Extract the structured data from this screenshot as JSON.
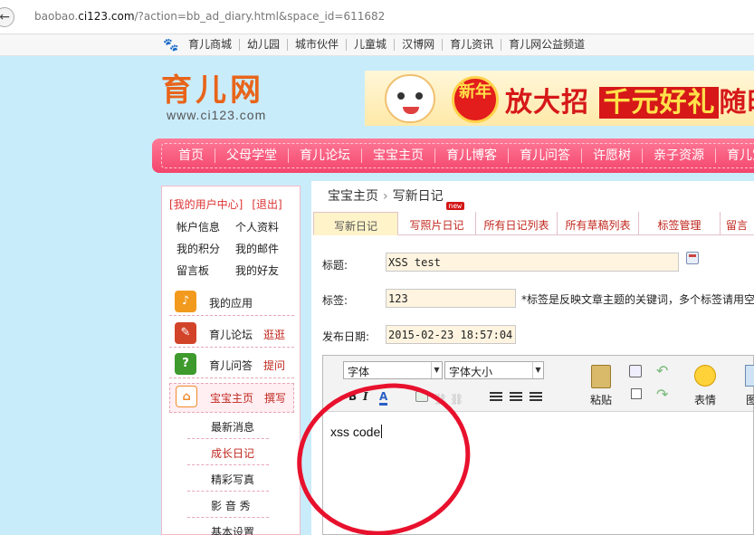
{
  "browser": {
    "url_prefix": "baobao.",
    "url_domain": "ci123.com",
    "url_path": "/?action=bb_ad_diary.html&space_id=611682"
  },
  "topnav": {
    "items": [
      "育儿商城",
      "幼儿园",
      "城市伙伴",
      "儿童城",
      "汉博网",
      "育儿资讯",
      "育儿网公益频道"
    ]
  },
  "logo": {
    "cn": "育儿网",
    "en": "www.ci123.com"
  },
  "banner": {
    "badge": "新年",
    "slogan_a": "放大招",
    "slogan_b": "千元好礼",
    "slogan_c": "随时"
  },
  "mainmenu": {
    "items": [
      "首页",
      "父母学堂",
      "育儿论坛",
      "宝宝主页",
      "育儿博客",
      "育儿问答",
      "许愿树",
      "亲子资源",
      "育儿宝"
    ]
  },
  "sidebar": {
    "user_center": "[我的用户中心]",
    "logout": "[退出]",
    "links": [
      [
        "帐户信息",
        "个人资料"
      ],
      [
        "我的积分",
        "我的邮件"
      ],
      [
        "留言板",
        "我的好友"
      ]
    ],
    "apps": [
      {
        "label": "我的应用",
        "action": "",
        "color": "#f29a1d",
        "icon": "app-icon"
      },
      {
        "label": "育儿论坛",
        "action": "逛逛",
        "color": "#d2442a",
        "icon": "forum-icon"
      },
      {
        "label": "育儿问答",
        "action": "提问",
        "color": "#3e9a2d",
        "icon": "question-icon"
      },
      {
        "label": "宝宝主页",
        "action": "撰写",
        "color": "#f08a2a",
        "icon": "home-icon"
      }
    ],
    "submenu": [
      "最新消息",
      "成长日记",
      "精彩写真",
      "影 音 秀",
      "基本设置"
    ]
  },
  "content": {
    "breadcrumb": [
      "宝宝主页",
      "写新日记"
    ],
    "tabs": [
      "写新日记",
      "写照片日记",
      "所有日记列表",
      "所有草稿列表",
      "标签管理",
      "留言"
    ],
    "new_badge": "new",
    "form": {
      "title_label": "标题:",
      "title_value": "XSS test",
      "tags_label": "标签:",
      "tags_value": "123",
      "tags_hint": "*标签是反映文章主题的关键词，多个标签请用空",
      "date_label": "发布日期:",
      "date_value": "2015-02-23 18:57:04"
    },
    "editor": {
      "font_select": "字体",
      "size_select": "字体大小",
      "paste_label": "粘贴",
      "emoji_label": "表情",
      "image_label": "图",
      "body_text": "xss code"
    }
  },
  "colors": {
    "menu_pink": "#f3446c",
    "accent_red": "#c0271e",
    "sky_blue": "#c9ecfb",
    "annotation_red": "#e8112d"
  }
}
